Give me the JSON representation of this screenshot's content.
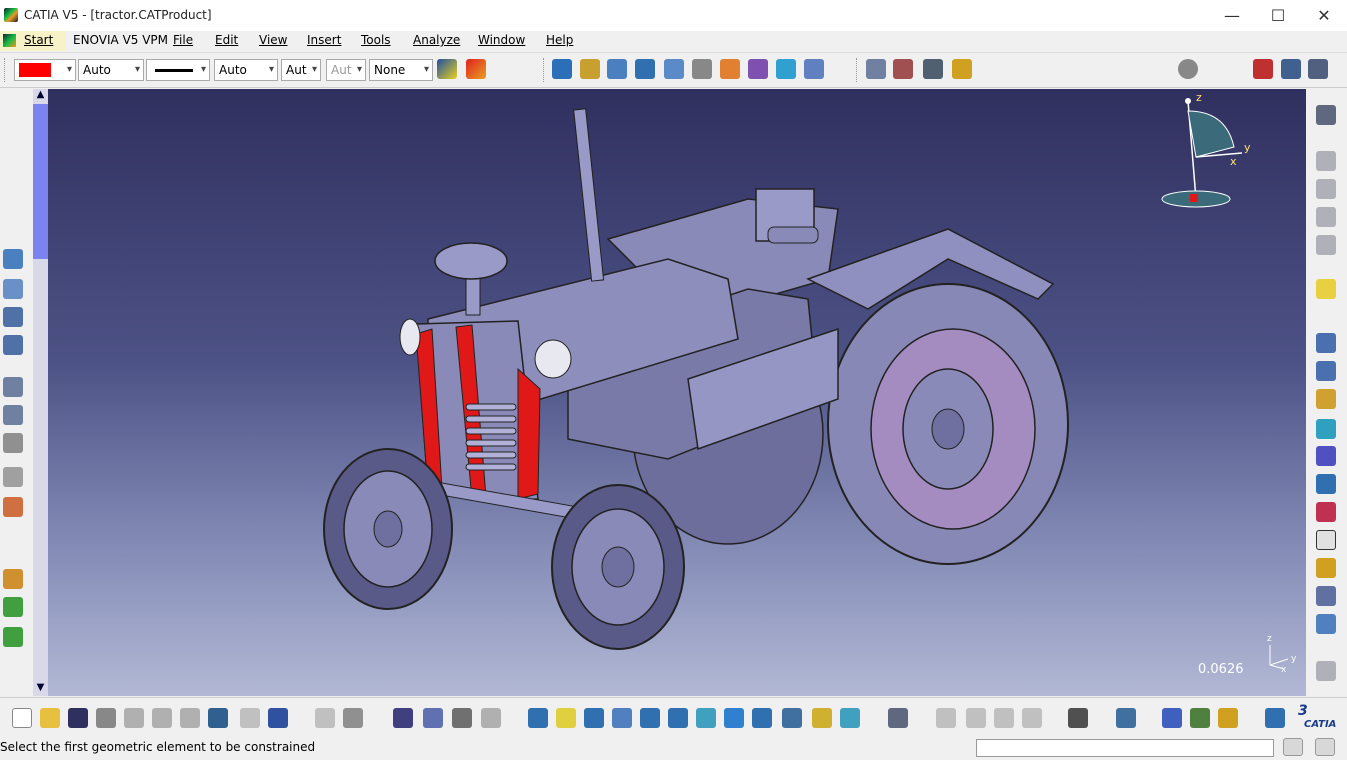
{
  "window": {
    "title": "CATIA V5 - [tractor.CATProduct]",
    "controls": {
      "minimize": "—",
      "maximize": "☐",
      "close": "✕"
    }
  },
  "menu": {
    "items": [
      "Start",
      "ENOVIA V5 VPM",
      "File",
      "Edit",
      "View",
      "Insert",
      "Tools",
      "Analyze",
      "Window",
      "Help"
    ],
    "mdi_controls": [
      "–",
      "⧉",
      "✕"
    ]
  },
  "properties_toolbar": {
    "color": "#ff0000",
    "transparency": "Auto",
    "linetype_icon": "solid-line-icon",
    "thickness": "Auto",
    "combo_a": "Aut",
    "combo_b": "Aut",
    "layer": "None"
  },
  "viewport": {
    "scale_value": "0.0626",
    "compass_labels": {
      "z": "z",
      "x": "x",
      "y": "y"
    },
    "mini_axis_labels": {
      "z": "z",
      "y": "y",
      "x": "x"
    }
  },
  "statusbar": {
    "message": "Select the first geometric element to be constrained",
    "command_value": ""
  },
  "colors": {
    "accent_red": "#ff0000",
    "viewport_top": "#30305f",
    "viewport_bottom": "#b2b8d4",
    "scroll_thumb": "#7b83f0",
    "start_highlight": "#f7f2c8",
    "model_gray": "#8c8cc0",
    "model_red": "#e01818"
  }
}
